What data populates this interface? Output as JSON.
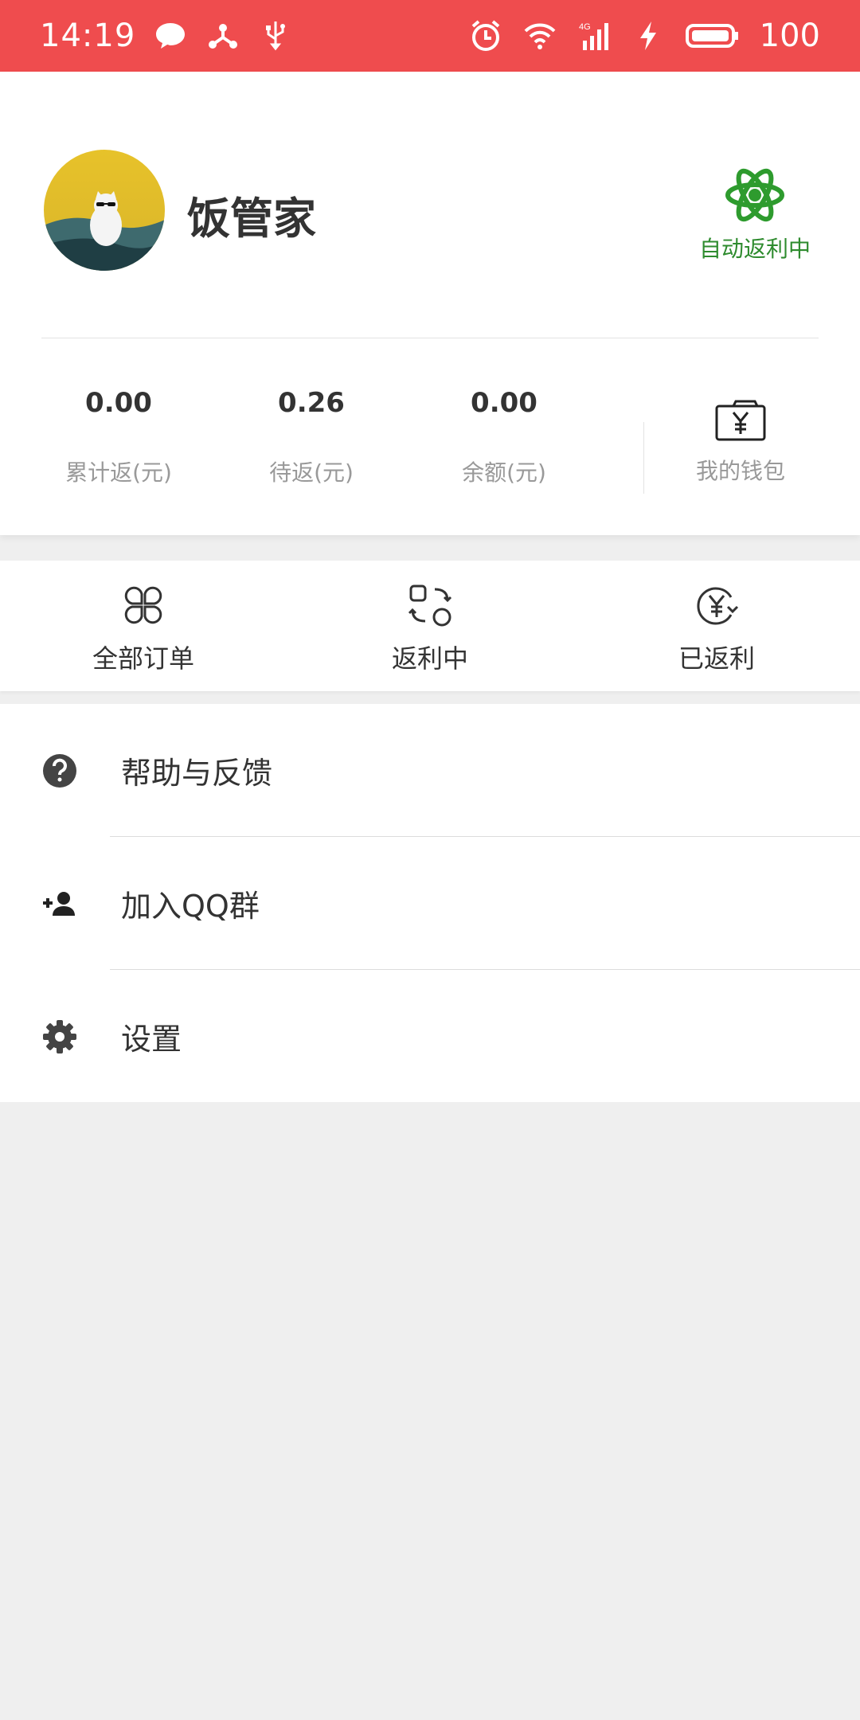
{
  "status_bar": {
    "time": "14:19",
    "icons_left": [
      "chat-bubble-icon",
      "share-hub-icon",
      "usb-icon"
    ],
    "icons_right": [
      "alarm-icon",
      "wifi-icon",
      "signal-4g-icon",
      "charging-icon",
      "battery-icon"
    ],
    "battery_text": "100",
    "background": "#ef4c4e"
  },
  "profile": {
    "username": "饭管家",
    "avatar_icon": "avatar-cat-image",
    "auto_rebate_label": "自动返利中",
    "auto_rebate_color": "#2e8b2e",
    "stats": [
      {
        "value": "0.00",
        "caption": "累计返(元)"
      },
      {
        "value": "0.26",
        "caption": "待返(元)"
      },
      {
        "value": "0.00",
        "caption": "余额(元)"
      }
    ],
    "wallet_label": "我的钱包",
    "wallet_icon": "wallet-yen-icon"
  },
  "orders": [
    {
      "label": "全部订单",
      "icon": "all-orders-clover-icon"
    },
    {
      "label": "返利中",
      "icon": "rebating-exchange-icon"
    },
    {
      "label": "已返利",
      "icon": "rebated-yen-cycle-icon"
    }
  ],
  "menu": [
    {
      "label": "帮助与反馈",
      "icon": "help-circle-icon"
    },
    {
      "label": "加入QQ群",
      "icon": "add-person-icon"
    },
    {
      "label": "设置",
      "icon": "gear-icon"
    }
  ]
}
